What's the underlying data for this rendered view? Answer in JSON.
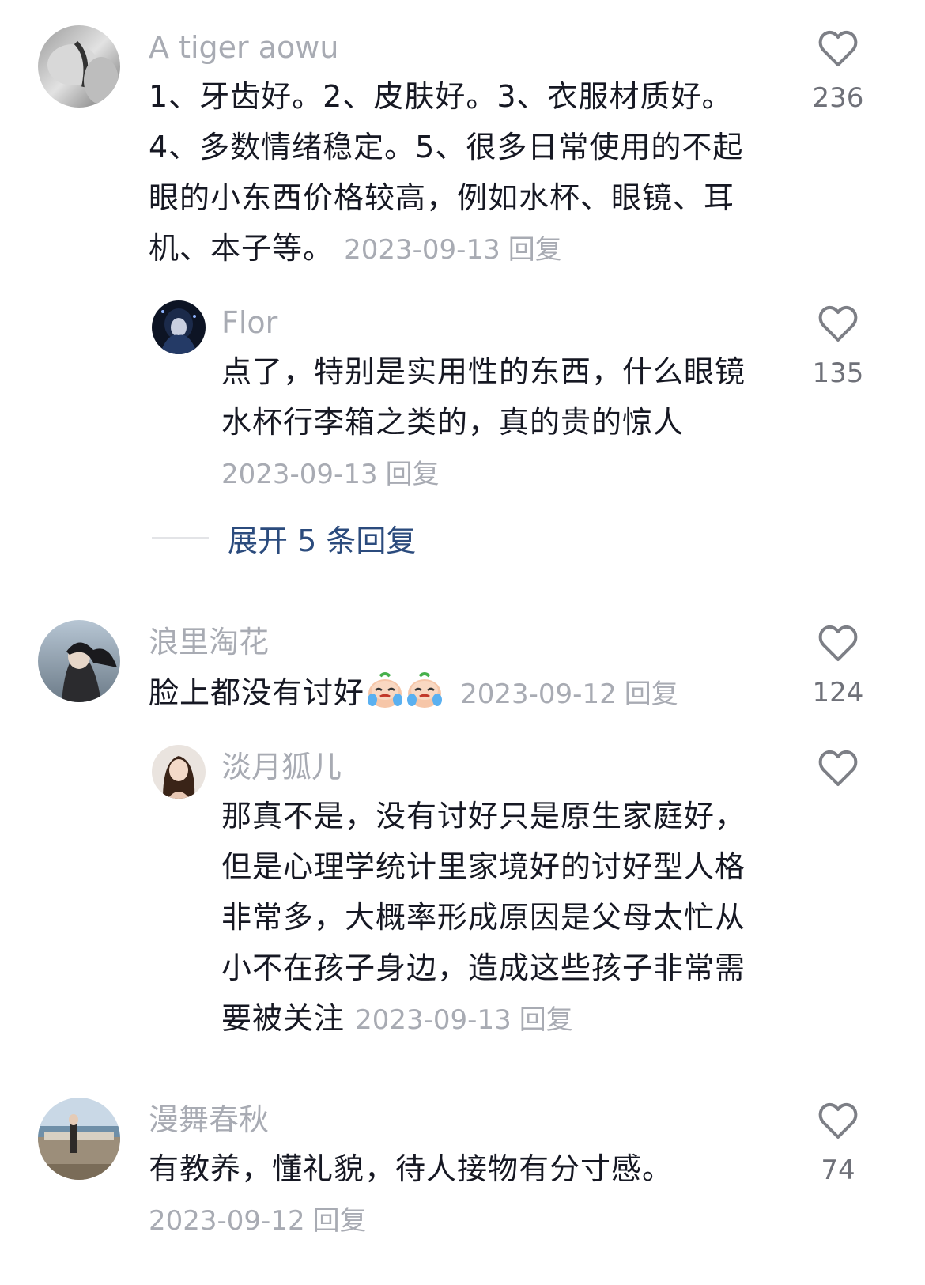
{
  "comments": [
    {
      "username": "A tiger aowu",
      "text": "1、牙齿好。2、皮肤好。3、衣服材质好。4、多数情绪稳定。5、很多日常使用的不起眼的小东西价格较高，例如水杯、眼镜、耳机、本子等。",
      "date": "2023-09-13",
      "reply_label": "回复",
      "likes": "236",
      "replies": [
        {
          "username": "Flor",
          "text": "点了，特别是实用性的东西，什么眼镜水杯行李箱之类的，真的贵的惊人",
          "date": "2023-09-13",
          "reply_label": "回复",
          "likes": "135"
        }
      ],
      "expand_label": "展开 5 条回复"
    },
    {
      "username": "浪里淘花",
      "text": "脸上都没有讨好",
      "emojis": [
        "crying-face-emoji",
        "crying-face-emoji"
      ],
      "date": "2023-09-12",
      "reply_label": "回复",
      "likes": "124",
      "replies": [
        {
          "username": "淡月狐儿",
          "text": "那真不是，没有讨好只是原生家庭好，但是心理学统计里家境好的讨好型人格非常多，大概率形成原因是父母太忙从小不在孩子身边，造成这些孩子非常需要被关注",
          "date": "2023-09-13",
          "reply_label": "回复",
          "likes": ""
        }
      ]
    },
    {
      "username": "漫舞春秋",
      "text": "有教养，懂礼貌，待人接物有分寸感。",
      "date": "2023-09-12",
      "reply_label": "回复",
      "likes": "74"
    }
  ],
  "icons": {
    "like": "heart-outline-icon",
    "emoji": "crying-face-emoji"
  },
  "colors": {
    "username": "#a8abb3",
    "text": "#161823",
    "meta": "#a8abb3",
    "like_count": "#6f7179",
    "expand_link": "#2b4b7d"
  }
}
